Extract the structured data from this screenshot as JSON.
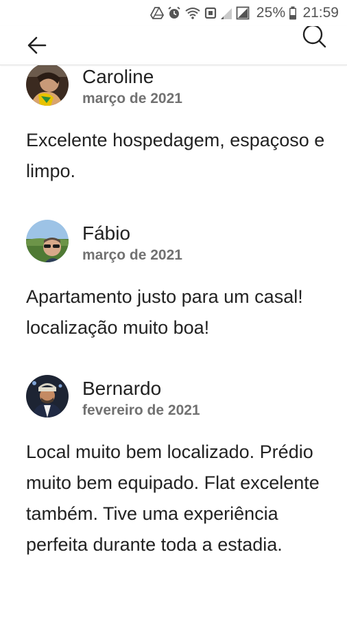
{
  "status_bar": {
    "battery": "25%",
    "time": "21:59"
  },
  "app_bar": {
    "back_icon": "arrow-left-icon",
    "search_icon": "search-icon"
  },
  "reviews": [
    {
      "name": "Caroline",
      "date": "março de 2021",
      "text": "Excelente hospedagem, espaçoso e limpo."
    },
    {
      "name": "Fábio",
      "date": "março de 2021",
      "text": "Apartamento justo para um casal! localização muito boa!"
    },
    {
      "name": "Bernardo",
      "date": "fevereiro de 2021",
      "text": "Local muito bem localizado. Prédio muito bem equipado. Flat excelente também. Tive uma experiência perfeita durante toda a estadia."
    }
  ],
  "colors": {
    "text_primary": "#222222",
    "text_secondary": "#717171",
    "divider": "#e2e2e2"
  }
}
